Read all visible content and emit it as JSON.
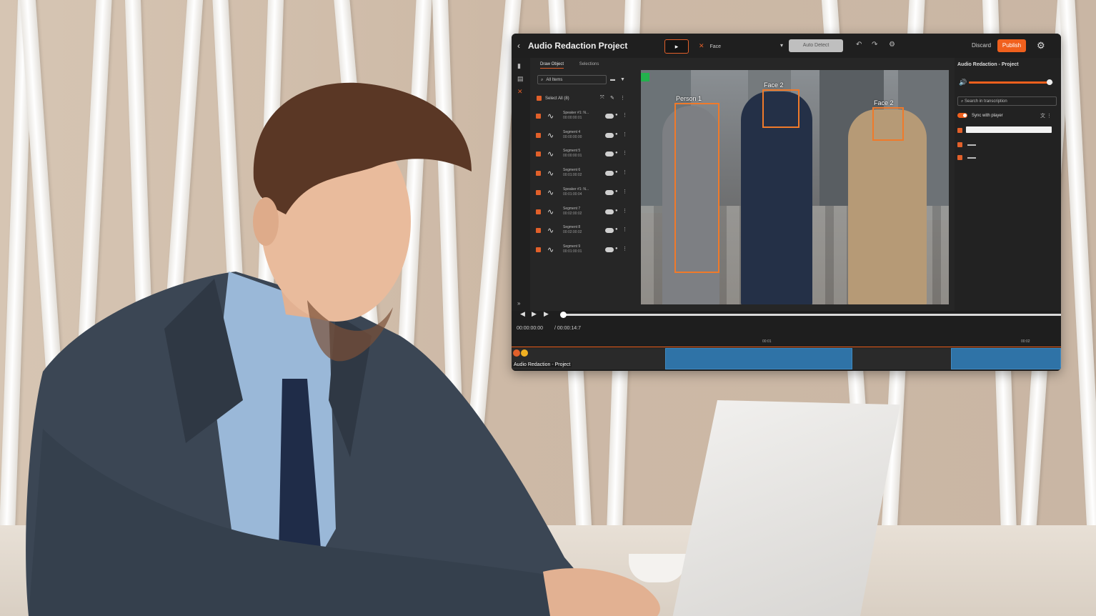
{
  "app": {
    "title": "Audio Redaction Project",
    "back_icon": "‹",
    "toolbar": {
      "pointer_icon": "▸",
      "face_label": "Face",
      "face_icon": "✕",
      "dropdown_icon": "▾",
      "auto_detect_label": "Auto Detect",
      "undo_icon": "↶",
      "redo_icon": "↷",
      "gear_icon": "⚙",
      "discard_label": "Discard",
      "publish_label": "Publish",
      "project_settings_icon": "⚙"
    },
    "left_panel": {
      "tabs": [
        "Draw Object",
        "Selections"
      ],
      "search_placeholder": "All Items",
      "select_all_label": "Select All (8)",
      "rows": [
        {
          "name": "Speaker #1: N...",
          "time": "00:00:00:01"
        },
        {
          "name": "Segment 4",
          "time": "00:00:00:00"
        },
        {
          "name": "Segment 5",
          "time": "00:00:00:01"
        },
        {
          "name": "Segment 6",
          "time": "00:01:00:02"
        },
        {
          "name": "Speaker #1: N...",
          "time": "00:01:00:04"
        },
        {
          "name": "Segment 7",
          "time": "00:02:00:02"
        },
        {
          "name": "Segment 8",
          "time": "00:02:00:02"
        },
        {
          "name": "Segment 9",
          "time": "00:01:00:01"
        }
      ]
    },
    "video": {
      "detections": [
        {
          "label": "Person 1"
        },
        {
          "label": "Face 2"
        },
        {
          "label": "Face 2"
        }
      ]
    },
    "right_panel": {
      "title": "Audio Redaction - Project",
      "volume_icon": "🔊",
      "volume_level": 0.96,
      "search_placeholder": "Search in transcription",
      "sync_label": "Sync with player"
    },
    "transport": {
      "current_time": "00:00:00:00",
      "duration": "/ 00:00:14:7",
      "ruler_ticks": [
        "00:01",
        "00:02"
      ],
      "track_name": "Audio Redaction - Project"
    },
    "colors": {
      "accent": "#f0601d",
      "box": "#f07a2a",
      "segment": "#2f73a7"
    }
  }
}
